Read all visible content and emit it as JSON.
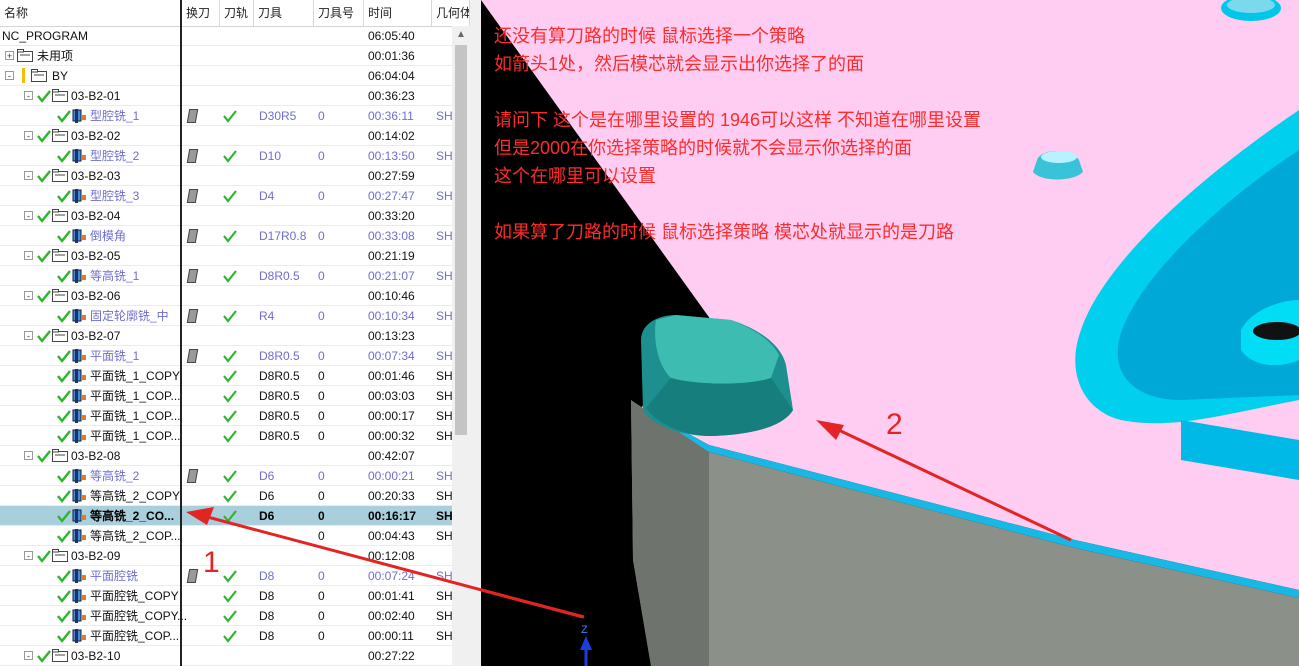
{
  "columns": [
    "名称",
    "换刀",
    "刀轨",
    "刀具",
    "刀具号",
    "时间",
    "几何体"
  ],
  "rows": [
    {
      "level": 0,
      "type": "root",
      "name": "NC_PROGRAM",
      "time": "06:05:40"
    },
    {
      "level": 1,
      "type": "folder",
      "expander": "+",
      "name": "未用项",
      "time": "00:01:36"
    },
    {
      "level": 1,
      "type": "folder",
      "expander": "-",
      "flag": true,
      "name": "BY",
      "time": "06:04:04"
    },
    {
      "level": 2,
      "type": "group",
      "expander": "-",
      "name": "03-B2-01",
      "time": "00:36:23"
    },
    {
      "level": 3,
      "type": "op",
      "icon": "cavity-mill-icon",
      "name": "型腔铣_1",
      "tc": true,
      "path": true,
      "tool": "D30R5",
      "num": "0",
      "time": "00:36:11",
      "geom": "SH",
      "dim": true
    },
    {
      "level": 2,
      "type": "group",
      "expander": "-",
      "name": "03-B2-02",
      "time": "00:14:02"
    },
    {
      "level": 3,
      "type": "op",
      "icon": "cavity-mill-icon",
      "name": "型腔铣_2",
      "tc": true,
      "path": true,
      "tool": "D10",
      "num": "0",
      "time": "00:13:50",
      "geom": "SH",
      "dim": true
    },
    {
      "level": 2,
      "type": "group",
      "expander": "-",
      "name": "03-B2-03",
      "time": "00:27:59"
    },
    {
      "level": 3,
      "type": "op",
      "icon": "cavity-mill-icon",
      "name": "型腔铣_3",
      "tc": true,
      "path": true,
      "tool": "D4",
      "num": "0",
      "time": "00:27:47",
      "geom": "SH",
      "dim": true
    },
    {
      "level": 2,
      "type": "group",
      "expander": "-",
      "name": "03-B2-04",
      "time": "00:33:20"
    },
    {
      "level": 3,
      "type": "op",
      "icon": "cavity-mill-icon",
      "name": "倒模角",
      "tc": true,
      "path": true,
      "tool": "D17R0.8",
      "num": "0",
      "time": "00:33:08",
      "geom": "SH",
      "dim": true
    },
    {
      "level": 2,
      "type": "group",
      "expander": "-",
      "name": "03-B2-05",
      "time": "00:21:19"
    },
    {
      "level": 3,
      "type": "op",
      "icon": "zlevel-icon",
      "name": "等高铣_1",
      "tc": true,
      "path": true,
      "tool": "D8R0.5",
      "num": "0",
      "time": "00:21:07",
      "geom": "SH",
      "dim": true
    },
    {
      "level": 2,
      "type": "group",
      "expander": "-",
      "name": "03-B2-06",
      "time": "00:10:46"
    },
    {
      "level": 3,
      "type": "op",
      "icon": "fixed-contour-icon",
      "name": "固定轮廓铣_中",
      "tc": true,
      "path": true,
      "tool": "R4",
      "num": "0",
      "time": "00:10:34",
      "geom": "SH",
      "dim": true
    },
    {
      "level": 2,
      "type": "group",
      "expander": "-",
      "name": "03-B2-07",
      "time": "00:13:23"
    },
    {
      "level": 3,
      "type": "op",
      "icon": "face-mill-icon",
      "name": "平面铣_1",
      "tc": true,
      "path": true,
      "tool": "D8R0.5",
      "num": "0",
      "time": "00:07:34",
      "geom": "SH",
      "dim": true
    },
    {
      "level": 3,
      "type": "op",
      "icon": "face-mill-icon",
      "name": "平面铣_1_COPY",
      "tc": false,
      "path": true,
      "tool": "D8R0.5",
      "num": "0",
      "time": "00:01:46",
      "geom": "SH"
    },
    {
      "level": 3,
      "type": "op",
      "icon": "face-mill-icon",
      "name": "平面铣_1_COP...",
      "tc": false,
      "path": true,
      "tool": "D8R0.5",
      "num": "0",
      "time": "00:03:03",
      "geom": "SH"
    },
    {
      "level": 3,
      "type": "op",
      "icon": "face-mill-icon",
      "name": "平面铣_1_COP...",
      "tc": false,
      "path": true,
      "tool": "D8R0.5",
      "num": "0",
      "time": "00:00:17",
      "geom": "SH"
    },
    {
      "level": 3,
      "type": "op",
      "icon": "face-mill-icon",
      "name": "平面铣_1_COP...",
      "tc": false,
      "path": true,
      "tool": "D8R0.5",
      "num": "0",
      "time": "00:00:32",
      "geom": "SH"
    },
    {
      "level": 2,
      "type": "group",
      "expander": "-",
      "name": "03-B2-08",
      "time": "00:42:07"
    },
    {
      "level": 3,
      "type": "op",
      "icon": "zlevel-icon",
      "name": "等高铣_2",
      "tc": true,
      "path": true,
      "tool": "D6",
      "num": "0",
      "time": "00:00:21",
      "geom": "SH",
      "dim": true
    },
    {
      "level": 3,
      "type": "op",
      "icon": "zlevel-icon",
      "name": "等高铣_2_COPY",
      "tc": false,
      "path": true,
      "tool": "D6",
      "num": "0",
      "time": "00:20:33",
      "geom": "SH"
    },
    {
      "level": 3,
      "type": "op",
      "icon": "zlevel-icon",
      "name": "等高铣_2_CO...",
      "tc": false,
      "path": true,
      "tool": "D6",
      "num": "0",
      "time": "00:16:17",
      "geom": "SH",
      "selected": true
    },
    {
      "level": 3,
      "type": "op",
      "icon": "zlevel-icon",
      "name": "等高铣_2_COP...",
      "tc": false,
      "path": false,
      "tool": "",
      "num": "0",
      "time": "00:04:43",
      "geom": "SH"
    },
    {
      "level": 2,
      "type": "group",
      "expander": "-",
      "name": "03-B2-09",
      "time": "00:12:08"
    },
    {
      "level": 3,
      "type": "op",
      "icon": "planar-pocket-icon",
      "name": "平面腔铣",
      "tc": true,
      "path": true,
      "tool": "D8",
      "num": "0",
      "time": "00:07:24",
      "geom": "SH",
      "dim": true
    },
    {
      "level": 3,
      "type": "op",
      "icon": "planar-pocket-icon",
      "name": "平面腔铣_COPY",
      "tc": false,
      "path": true,
      "tool": "D8",
      "num": "0",
      "time": "00:01:41",
      "geom": "SH"
    },
    {
      "level": 3,
      "type": "op",
      "icon": "planar-pocket-icon",
      "name": "平面腔铣_COPY...",
      "tc": false,
      "path": true,
      "tool": "D8",
      "num": "0",
      "time": "00:02:40",
      "geom": "SH"
    },
    {
      "level": 3,
      "type": "op",
      "icon": "planar-pocket-icon",
      "name": "平面腔铣_COP...",
      "tc": false,
      "path": true,
      "tool": "D8",
      "num": "0",
      "time": "00:00:11",
      "geom": "SH"
    },
    {
      "level": 2,
      "type": "group",
      "expander": "-",
      "name": "03-B2-10",
      "time": "00:27:22"
    }
  ],
  "notes": [
    "还没有算刀路的时候 鼠标选择一个策略",
    "如箭头1处，然后模芯就会显示出你选择了的面",
    "请问下 这个是在哪里设置的 1946可以这样 不知道在哪里设置",
    "但是2000在你选择策略的时候就不会显示你选择的面",
    "这个在哪里可以设置",
    "如果算了刀路的时候 鼠标选择策略 模芯处就显示的是刀路"
  ],
  "labels": {
    "arrow1": "1",
    "arrow2": "2",
    "axis": "Z"
  },
  "colors": {
    "check": "#2db52d",
    "dim_text": "#6e6ed0",
    "selected": "#a9cfdc",
    "note": "#ff2b2b",
    "arrow": "#e32424",
    "pink_face": "#ffcdf2",
    "cyan_part": "#00d2f0",
    "teal_block": "#1f8f8f",
    "gray_wall": "#8b9088"
  }
}
